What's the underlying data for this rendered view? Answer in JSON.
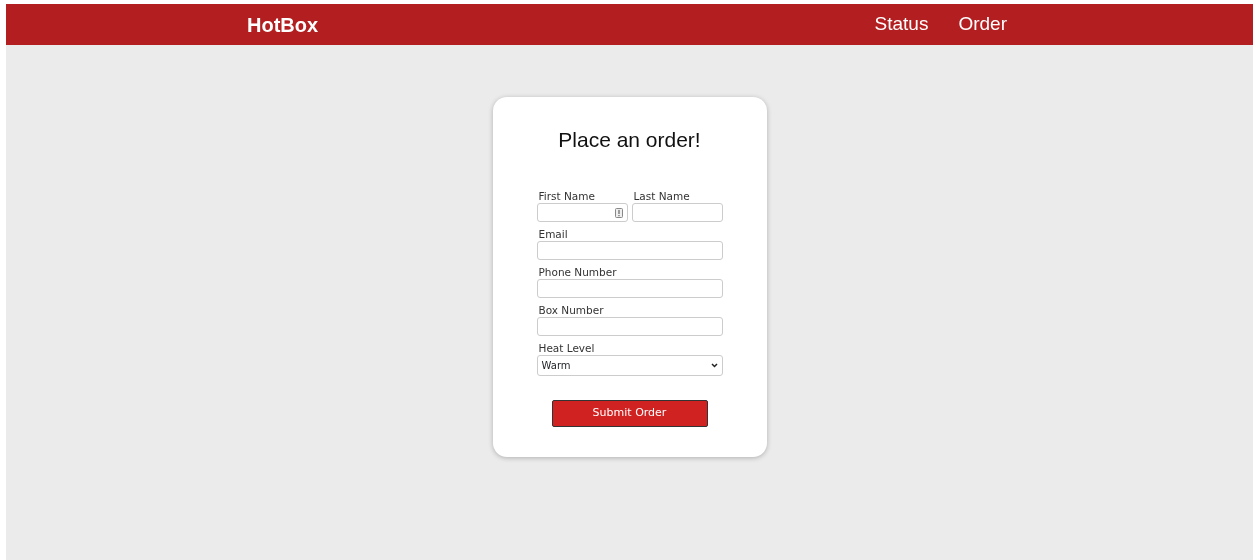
{
  "navbar": {
    "brand": "HotBox",
    "links": [
      {
        "label": "Status"
      },
      {
        "label": "Order"
      }
    ]
  },
  "form": {
    "title": "Place an order!",
    "name_fields": [
      {
        "label": "First Name",
        "autofill_icon": true
      },
      {
        "label": "Last Name",
        "autofill_icon": false
      }
    ],
    "fields": [
      {
        "label": "Email"
      },
      {
        "label": "Phone Number"
      },
      {
        "label": "Box Number"
      }
    ],
    "heat_level": {
      "label": "Heat Level",
      "value": "Warm"
    },
    "submit": "Submit Order"
  }
}
